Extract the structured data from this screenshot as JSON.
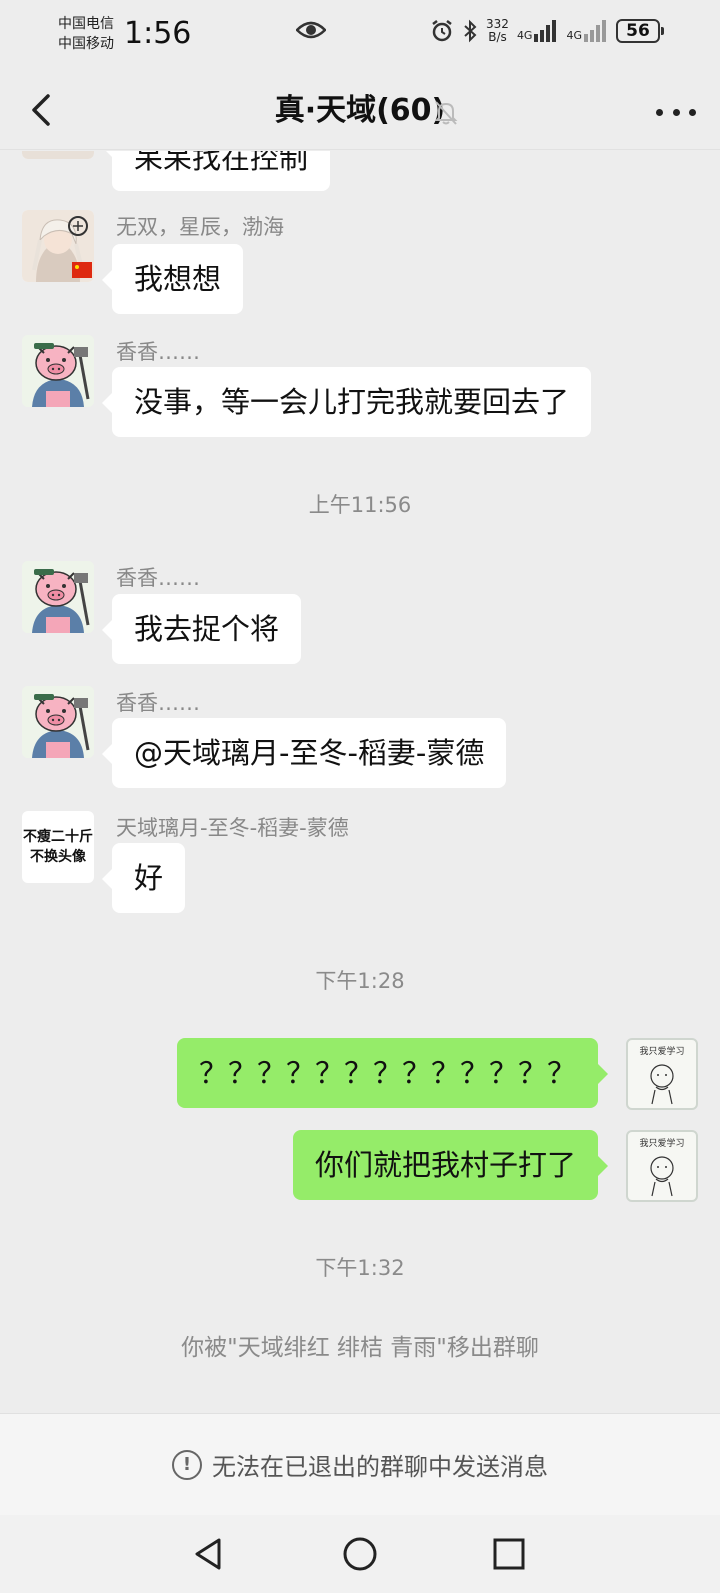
{
  "status_bar": {
    "carrier_1": "中国电信",
    "carrier_2": "中国移动",
    "time": "1:56",
    "net_speed_value": "332",
    "net_speed_unit": "B/s",
    "network_1": "4G",
    "network_2": "4G",
    "battery": "56"
  },
  "header": {
    "title": "真·天域(60)"
  },
  "messages": [
    {
      "kind": "in",
      "sender": "",
      "text": "呆呆找在控制",
      "avatar": "anime-avatar"
    },
    {
      "kind": "in",
      "sender": "无双，星辰，渤海",
      "text": "我想想",
      "avatar": "anime-avatar"
    },
    {
      "kind": "in",
      "sender": "香香……",
      "text": "没事，等一会儿打完我就要回去了",
      "avatar": "pig-avatar"
    },
    {
      "kind": "time",
      "text": "上午11:56"
    },
    {
      "kind": "in",
      "sender": "香香……",
      "text": "我去捉个将",
      "avatar": "pig-avatar"
    },
    {
      "kind": "in",
      "sender": "香香……",
      "text": "@天域璃月-至冬-稻妻-蒙德",
      "avatar": "pig-avatar"
    },
    {
      "kind": "in",
      "sender": "天域璃月-至冬-稻妻-蒙德",
      "text": "好",
      "avatar": "text-avatar"
    },
    {
      "kind": "time",
      "text": "下午1:28"
    },
    {
      "kind": "out",
      "text": "？？？？？？？？？？？？？",
      "avatar": "sketch-avatar"
    },
    {
      "kind": "out",
      "text": "你们就把我村子打了",
      "avatar": "sketch-avatar"
    },
    {
      "kind": "time",
      "text": "下午1:32"
    },
    {
      "kind": "system",
      "text": "你被\"天域绯红 绯桔  青雨\"移出群聊"
    }
  ],
  "text_avatar": {
    "line1": "不瘦二十斤",
    "line2": "不换头像"
  },
  "sketch_avatar": {
    "caption": "我只爱学习"
  },
  "notice": {
    "icon": "!",
    "text": "无法在已退出的群聊中发送消息"
  },
  "colors": {
    "background": "#ededed",
    "outgoing_bubble": "#95ec69",
    "incoming_bubble": "#ffffff"
  }
}
